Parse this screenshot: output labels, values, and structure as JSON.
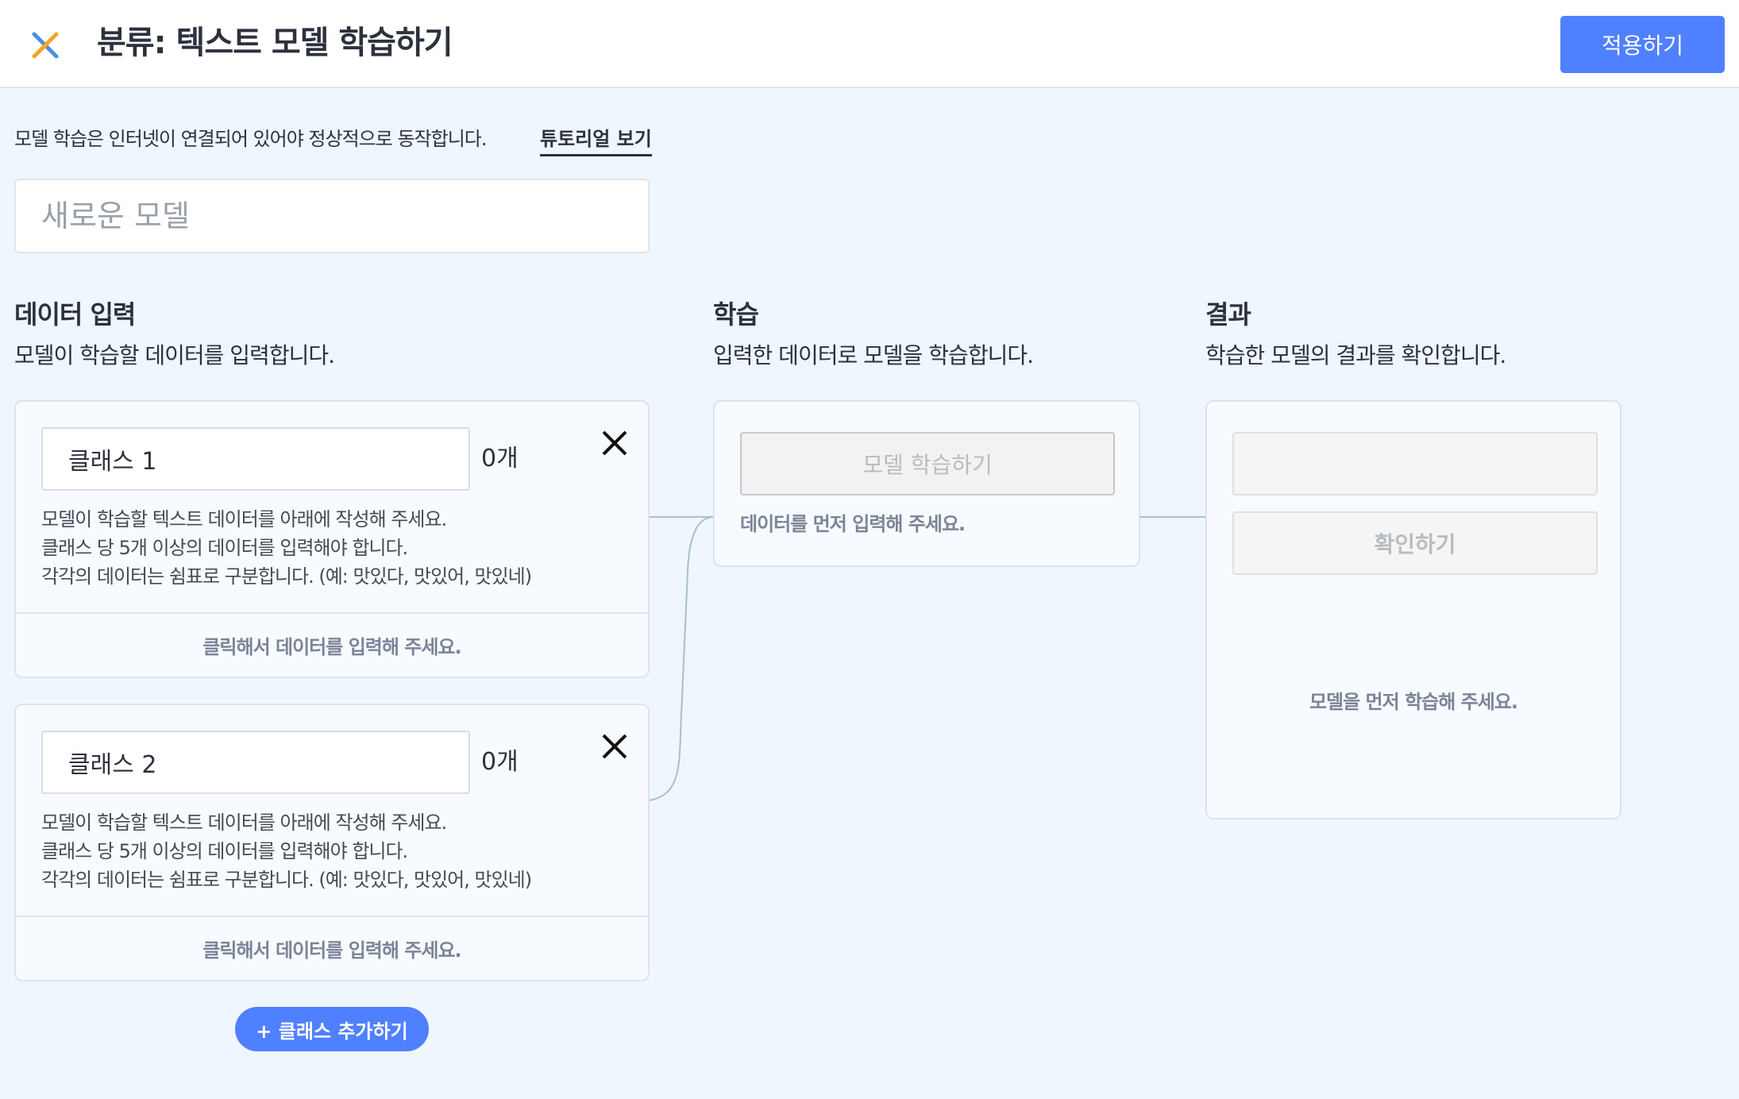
{
  "header": {
    "title": "분류: 텍스트 모델 학습하기",
    "apply_label": "적용하기",
    "close_icon": "close-icon"
  },
  "notice": {
    "text": "모델 학습은 인터넷이 연결되어 있어야 정상적으로 동작합니다.",
    "tutorial_link": "튜토리얼 보기"
  },
  "model": {
    "name_value": "",
    "name_placeholder": "새로운 모델"
  },
  "data_input": {
    "title": "데이터 입력",
    "description": "모델이 학습할 데이터를 입력합니다.",
    "classes": [
      {
        "name": "클래스 1",
        "count": "0개",
        "desc_lines": [
          "모델이 학습할 텍스트 데이터를 아래에 작성해 주세요.",
          "클래스 당 5개 이상의 데이터를 입력해야 합니다.",
          "각각의 데이터는 쉼표로 구분합니다. (예: 맛있다, 맛있어, 맛있네)"
        ],
        "click_prompt": "클릭해서 데이터를 입력해 주세요."
      },
      {
        "name": "클래스 2",
        "count": "0개",
        "desc_lines": [
          "모델이 학습할 텍스트 데이터를 아래에 작성해 주세요.",
          "클래스 당 5개 이상의 데이터를 입력해야 합니다.",
          "각각의 데이터는 쉼표로 구분합니다. (예: 맛있다, 맛있어, 맛있네)"
        ],
        "click_prompt": "클릭해서 데이터를 입력해 주세요."
      }
    ],
    "add_class_label": "+ 클래스 추가하기"
  },
  "training": {
    "title": "학습",
    "description": "입력한 데이터로 모델을 학습합니다.",
    "train_button": "모델 학습하기",
    "hint": "데이터를 먼저 입력해 주세요."
  },
  "result": {
    "title": "결과",
    "description": "학습한 모델의 결과를 확인합니다.",
    "test_input_value": "",
    "confirm_button": "확인하기",
    "hint": "모델을 먼저 학습해 주세요."
  },
  "colors": {
    "accent": "#4f80ff",
    "background": "#eff6fd",
    "card": "#f7fbff",
    "hint_text": "#7b8497",
    "connector": "#a9c0cc",
    "close_icon_blue": "#4a90e2",
    "close_icon_orange": "#f5a623"
  }
}
